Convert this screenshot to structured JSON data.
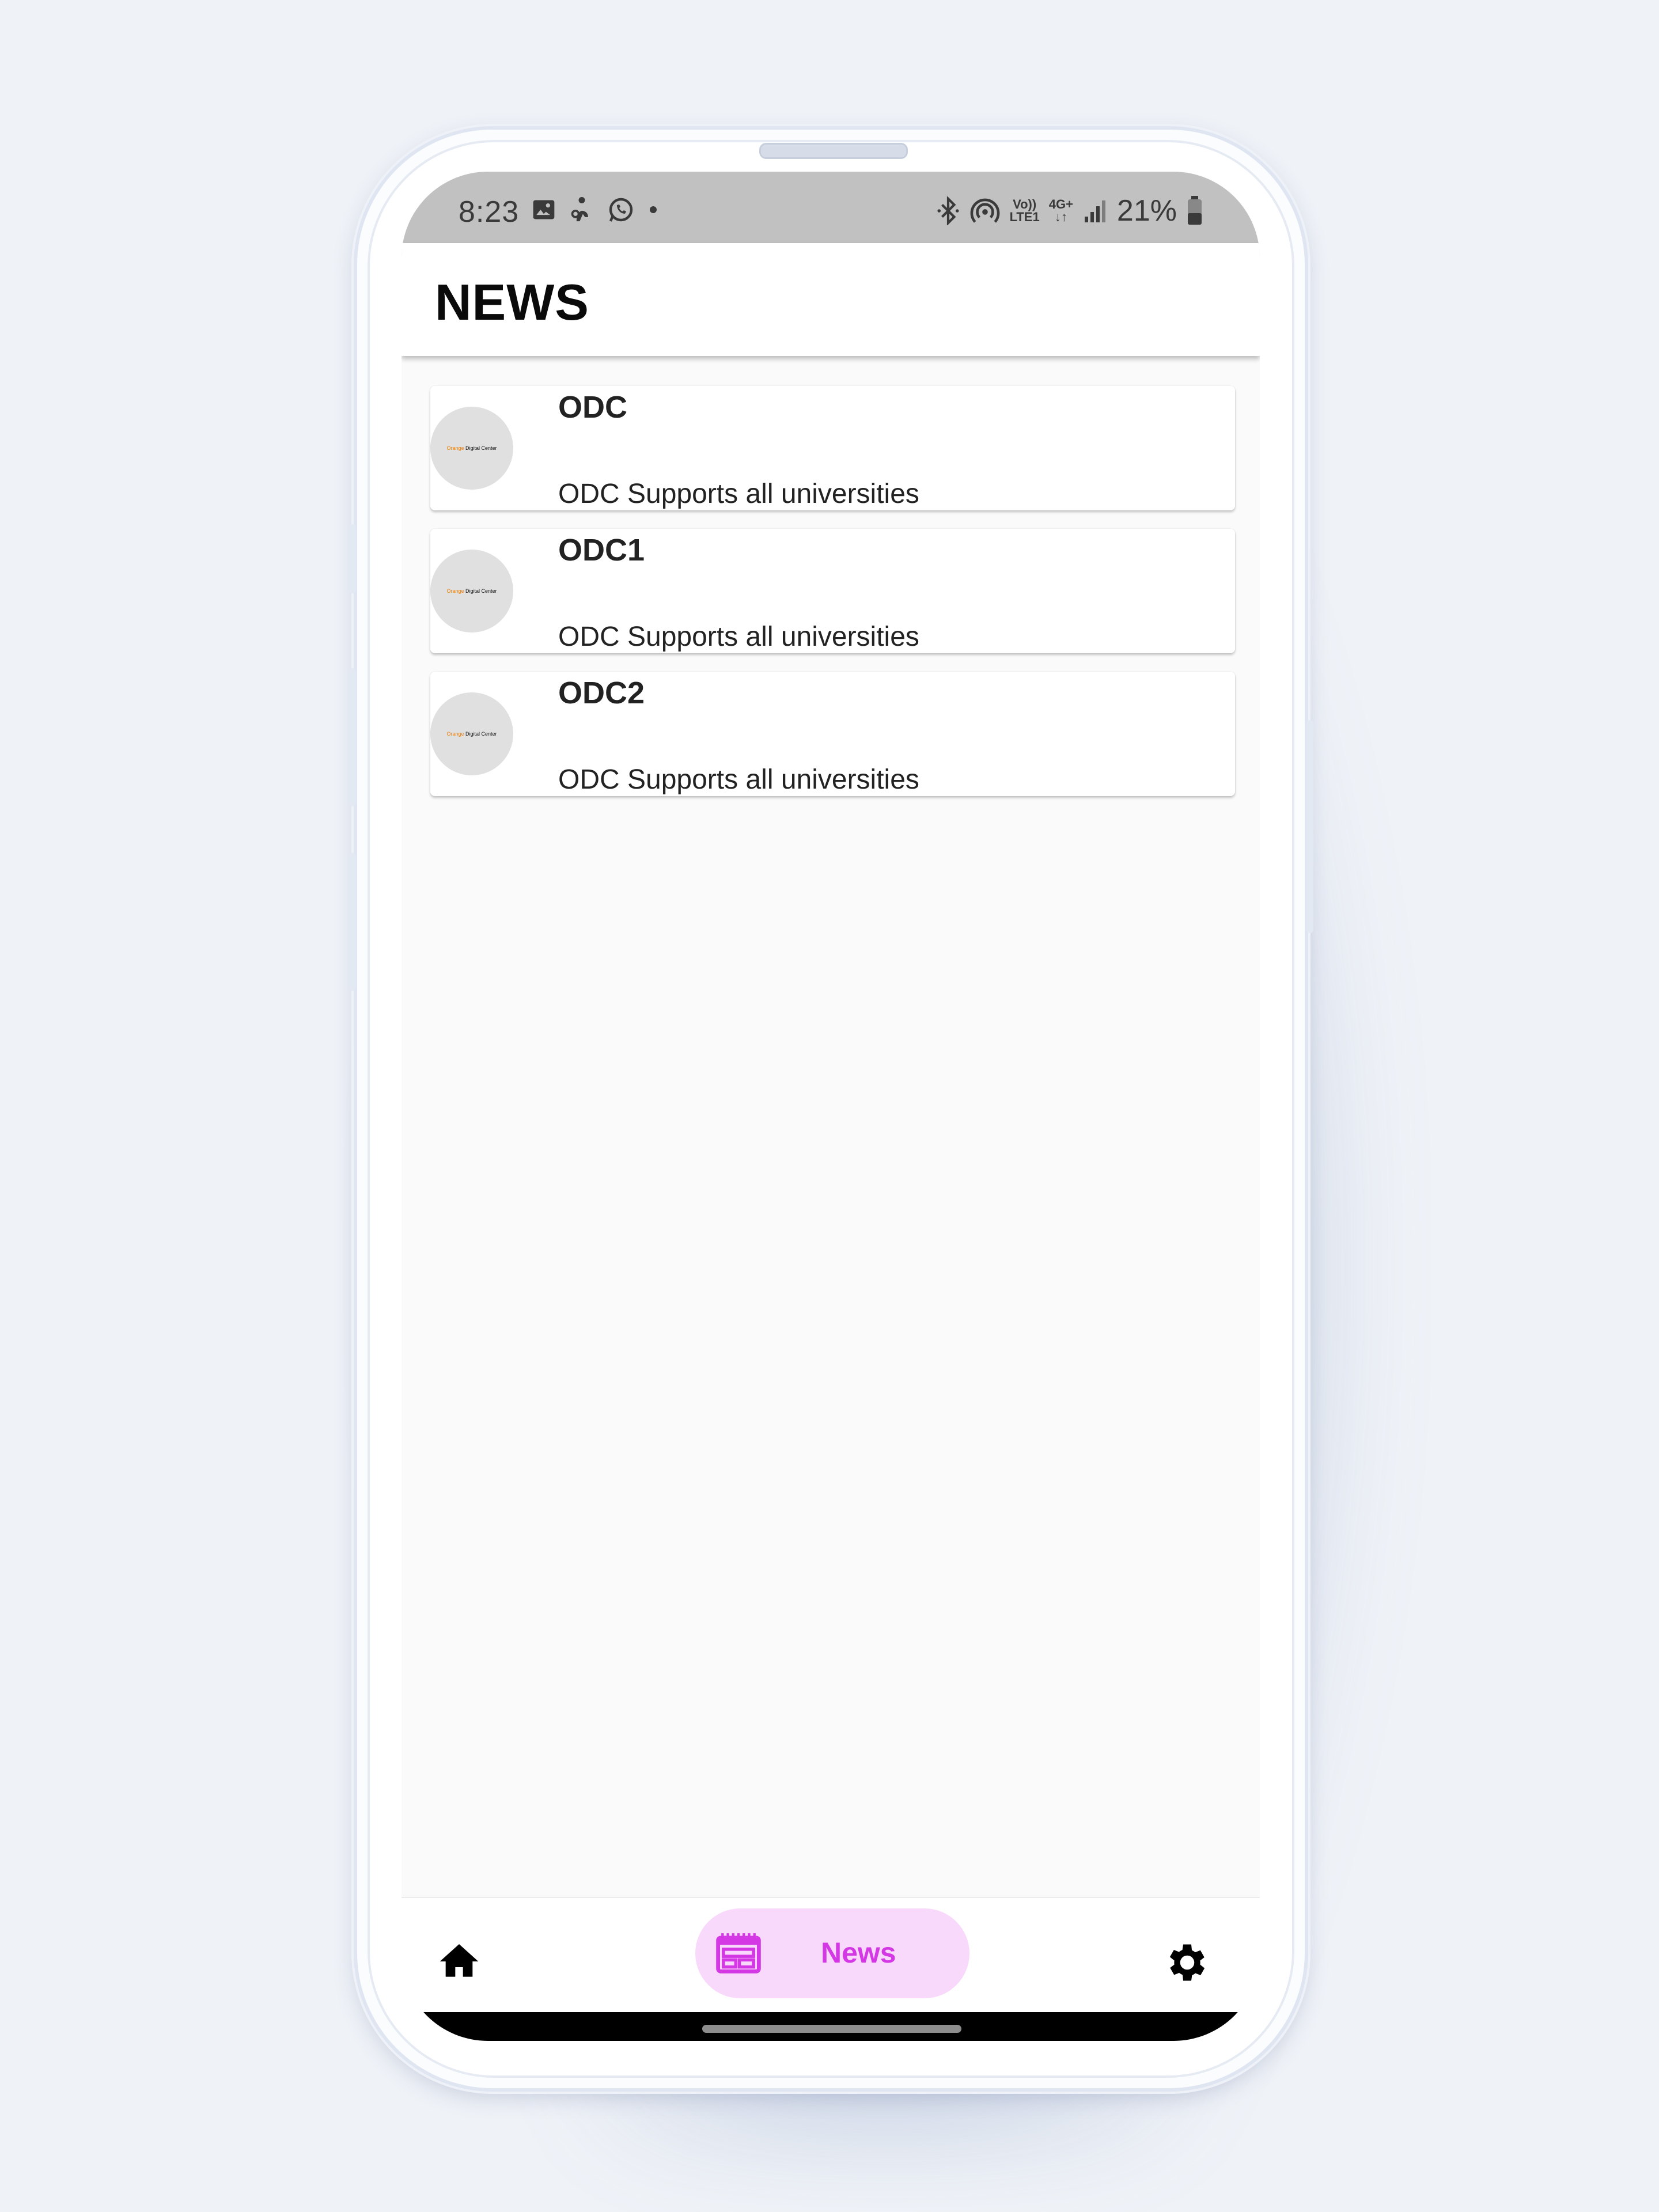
{
  "status_bar": {
    "time": "8:23",
    "left_icons": [
      "gallery-icon",
      "accessibility-icon",
      "whatsapp-icon",
      "notification-dot-icon"
    ],
    "right_icons": [
      "bluetooth-icon",
      "hotspot-icon",
      "volte-icon",
      "4g-icon",
      "signal-icon",
      "battery-icon"
    ],
    "volte_top": "Vo))",
    "volte_bottom": "LTE1",
    "network_label": "4G+",
    "battery": "21%"
  },
  "app_bar": {
    "title": "NEWS"
  },
  "news_items": [
    {
      "title": "ODC",
      "subtitle": "ODC Supports all universities",
      "logo_orange": "Orange",
      "logo_text": "Digital Center"
    },
    {
      "title": "ODC1",
      "subtitle": "ODC Supports all universities",
      "logo_orange": "Orange",
      "logo_text": "Digital Center"
    },
    {
      "title": "ODC2",
      "subtitle": "ODC Supports all universities",
      "logo_orange": "Orange",
      "logo_text": "Digital Center"
    }
  ],
  "bottom_nav": {
    "items": [
      {
        "name": "home",
        "icon": "home-icon",
        "selected": false
      },
      {
        "name": "news",
        "icon": "newspaper-icon",
        "label": "News",
        "selected": true
      },
      {
        "name": "settings",
        "icon": "gear-icon",
        "selected": false
      }
    ],
    "selected_color": "#d437e4",
    "selected_bg": "#f9d9fb"
  }
}
